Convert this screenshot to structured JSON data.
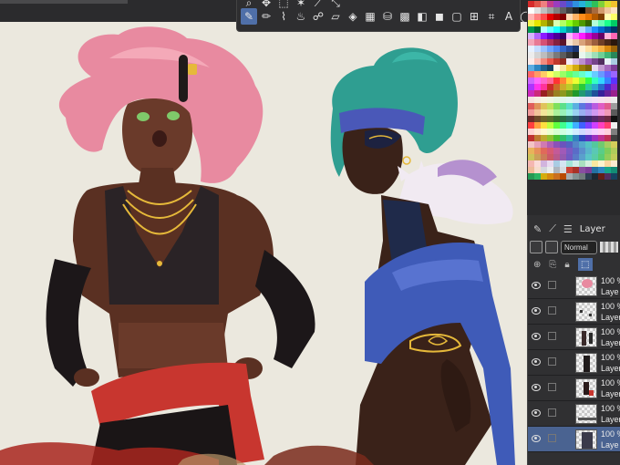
{
  "app": {
    "accent_color": "#4f6fa8",
    "panel_color": "#303032"
  },
  "toolbar": {
    "row1_tools": [
      {
        "name": "zoom-icon",
        "glyph": "⌕"
      },
      {
        "name": "move-icon",
        "glyph": "✥"
      },
      {
        "name": "selection-icon",
        "glyph": "⬚"
      },
      {
        "name": "magic-wand-icon",
        "glyph": "✶"
      },
      {
        "name": "eyedropper-icon",
        "glyph": "⟋"
      },
      {
        "name": "transform-icon",
        "glyph": "⤡"
      }
    ],
    "row2_tools": [
      {
        "name": "pen-icon",
        "glyph": "✎",
        "active": true
      },
      {
        "name": "pencil-icon",
        "glyph": "✏"
      },
      {
        "name": "brush-icon",
        "glyph": "⌇"
      },
      {
        "name": "airbrush-icon",
        "glyph": "♨"
      },
      {
        "name": "blend-icon",
        "glyph": "☍"
      },
      {
        "name": "eraser-icon",
        "glyph": "▱"
      },
      {
        "name": "fill-icon",
        "glyph": "◈"
      },
      {
        "name": "grid-icon",
        "glyph": "▦"
      },
      {
        "name": "bucket-icon",
        "glyph": "⛁"
      },
      {
        "name": "pattern-icon",
        "glyph": "▩"
      },
      {
        "name": "gradient-icon",
        "glyph": "◧"
      },
      {
        "name": "shape-icon",
        "glyph": "◼"
      },
      {
        "name": "rectangle-icon",
        "glyph": "▢"
      },
      {
        "name": "frame-icon",
        "glyph": "⊞"
      },
      {
        "name": "ruler-icon",
        "glyph": "⌗"
      },
      {
        "name": "text-icon",
        "glyph": "A"
      },
      {
        "name": "balloon-icon",
        "glyph": "◯"
      },
      {
        "name": "correction-icon",
        "glyph": "✐"
      }
    ]
  },
  "palette": {
    "colors": [
      "#d62b2b",
      "#e0554a",
      "#f08080",
      "#c43c8c",
      "#9b3dbf",
      "#6b49c9",
      "#3b5fd4",
      "#2f8fe0",
      "#26b1d8",
      "#21c2a0",
      "#2fbf5a",
      "#7fd13a",
      "#d7df30",
      "#f2c12e",
      "#ffffff",
      "#e0e0e0",
      "#c0c0c0",
      "#a0a0a0",
      "#808080",
      "#606060",
      "#404040",
      "#202020",
      "#000000",
      "#7a4b2a",
      "#a86a3d",
      "#d39b6c",
      "#f0c8a0",
      "#ffe1c4",
      "#ffb3b3",
      "#ff8080",
      "#ff4d4d",
      "#e60000",
      "#b30000",
      "#800000",
      "#ffd9b3",
      "#ffb366",
      "#ff8c1a",
      "#e67300",
      "#b35900",
      "#804000",
      "#ffffb3",
      "#ffff66",
      "#f5f54d",
      "#e6e600",
      "#b3b300",
      "#808000",
      "#d9ffb3",
      "#b3ff66",
      "#8cff1a",
      "#66cc00",
      "#4d9900",
      "#336600",
      "#b3ffd9",
      "#66ffb3",
      "#1aff8c",
      "#00cc66",
      "#009950",
      "#006633",
      "#b3ffff",
      "#66ffff",
      "#1affff",
      "#00cccc",
      "#009999",
      "#006666",
      "#b3d9ff",
      "#66b3ff",
      "#1a8cff",
      "#0066cc",
      "#004d99",
      "#003366",
      "#d9b3ff",
      "#b366ff",
      "#8c1aff",
      "#6600cc",
      "#4d0099",
      "#330066",
      "#ffb3ff",
      "#ff66ff",
      "#ff1aff",
      "#cc00cc",
      "#990099",
      "#660066",
      "#ffb3d9",
      "#ff66b3",
      "#f4a6b8",
      "#e87a95",
      "#d64f74",
      "#b03358",
      "#85213f",
      "#5c1529",
      "#f6e3d1",
      "#e9c6a6",
      "#d9a27b",
      "#c27f58",
      "#9c5e3d",
      "#6f3f27",
      "#4a2919",
      "#2b170d",
      "#e8f1ff",
      "#c6dcff",
      "#9cc1ff",
      "#6ea3ff",
      "#4f86f0",
      "#3566c9",
      "#264c9e",
      "#1a3572",
      "#fff1d6",
      "#ffe0a3",
      "#ffcc66",
      "#f5b041",
      "#d68910",
      "#9a6308",
      "#ededed",
      "#d4d4d4",
      "#bdbdbd",
      "#9e9e9e",
      "#7a7a7a",
      "#5c5c5c",
      "#3d3d3d",
      "#1f1f1f",
      "#e9f7ef",
      "#c8ecd6",
      "#9edfb9",
      "#6fcf97",
      "#40b676",
      "#27865a",
      "#fdecea",
      "#f9c0b8",
      "#f28c7f",
      "#e9584b",
      "#c0392b",
      "#922b21",
      "#f4ecf7",
      "#d7bde2",
      "#bb8fce",
      "#9b59b6",
      "#76448a",
      "#512e5f",
      "#eaf2f8",
      "#a9cce3",
      "#5dade2",
      "#2e86c1",
      "#1f618d",
      "#154360",
      "#fef9e7",
      "#f9e79f",
      "#f4d03f",
      "#d4ac0d",
      "#9a7d0a",
      "#7d6608",
      "#e8daef",
      "#c39bd3",
      "#a569bd",
      "#7d3c98",
      "#ff6666",
      "#ff9966",
      "#ffcc66",
      "#ffff66",
      "#ccff66",
      "#99ff66",
      "#66ff66",
      "#66ff99",
      "#66ffcc",
      "#66ffff",
      "#66ccff",
      "#6699ff",
      "#6666ff",
      "#9966ff",
      "#cc66ff",
      "#ff66ff",
      "#ff66cc",
      "#ff6699",
      "#ff3333",
      "#ff8533",
      "#ffd633",
      "#ebff33",
      "#99ff33",
      "#33ff47",
      "#33ffc2",
      "#33d6ff",
      "#3385ff",
      "#5c33ff",
      "#ad33ff",
      "#ff33eb",
      "#ff3399",
      "#cc2929",
      "#cc6b29",
      "#ccab29",
      "#bccc29",
      "#7acc29",
      "#29cc39",
      "#29cc9b",
      "#29abcc",
      "#296bcc",
      "#4a29cc",
      "#8a29cc",
      "#cc29bc",
      "#cc297a",
      "#992020",
      "#995020",
      "#998020",
      "#8d9920",
      "#5c9920",
      "#20992b",
      "#209974",
      "#208099",
      "#205099",
      "#372099",
      "#672099",
      "#99208d",
      "#f7e0e0",
      "#f7ece0",
      "#f7f4e0",
      "#f0f7e0",
      "#e4f7e0",
      "#e0f7ea",
      "#e0f7f5",
      "#e0eff7",
      "#e0e5f7",
      "#e8e0f7",
      "#f2e0f7",
      "#f7e0f0",
      "#f7e0e6",
      "#ebebeb",
      "#e05c5c",
      "#e0935c",
      "#e0c45c",
      "#c4e05c",
      "#7ee05c",
      "#5ce08a",
      "#5ce0c9",
      "#5cb0e0",
      "#5c76e0",
      "#7e5ce0",
      "#b85ce0",
      "#e05cc4",
      "#e05c8e",
      "#9c9c9c",
      "#f19a9a",
      "#f1c29a",
      "#f1e59a",
      "#dcf19a",
      "#abf19a",
      "#9af1b9",
      "#9af1e3",
      "#9ad2f1",
      "#9aaef1",
      "#ab9af1",
      "#d09af1",
      "#f19adf",
      "#f19ab6",
      "#5b5b5b",
      "#6d2a2a",
      "#6d4a2a",
      "#6d632a",
      "#5a6d2a",
      "#376d2a",
      "#2a6d41",
      "#2a6d62",
      "#2a536d",
      "#2a366d",
      "#3a2a6d",
      "#552a6d",
      "#6d2a5f",
      "#6d2a41",
      "#111111",
      "#ff4040",
      "#ffa040",
      "#ffe040",
      "#c0ff40",
      "#60ff40",
      "#40ff90",
      "#40ffe0",
      "#40b0ff",
      "#4060ff",
      "#8040ff",
      "#d040ff",
      "#ff40c0",
      "#ff4070",
      "#f0f0f0",
      "#ffd0d0",
      "#ffe6d0",
      "#fff8d0",
      "#ecffd0",
      "#d6ffd0",
      "#d0ffe2",
      "#d0fff7",
      "#d0ecff",
      "#d0d9ff",
      "#e2d0ff",
      "#f4d0ff",
      "#ffd0f2",
      "#ffd0dc",
      "#7f7f7f",
      "#bf3030",
      "#bf7830",
      "#bfa830",
      "#90bf30",
      "#48bf30",
      "#30bf6c",
      "#30bfa8",
      "#3084bf",
      "#3048bf",
      "#6030bf",
      "#9c30bf",
      "#bf3090",
      "#bf3054",
      "#3f3f3f",
      "#f3c5c5",
      "#e6a0b8",
      "#d07ab2",
      "#b05fb5",
      "#8a52b8",
      "#6b54bd",
      "#5463c2",
      "#5486c8",
      "#54a8cc",
      "#54c2c4",
      "#54c79e",
      "#70c970",
      "#a6cc60",
      "#d4ce5a",
      "#e8b35a",
      "#e6905a",
      "#e06a5a",
      "#d65a74",
      "#c45a98",
      "#a05ab8",
      "#7a5ac2",
      "#5a6cc8",
      "#5a90cc",
      "#5ab4cc",
      "#5ac8b4",
      "#5acc88",
      "#7ecc5a",
      "#b0cc5a",
      "#ccc45a",
      "#cca05a",
      "#cc7c5a",
      "#cc5a66",
      "#b85a8c",
      "#945ab0",
      "#705ac2",
      "#5a7ac8",
      "#5aa0cc",
      "#5ac4c8",
      "#5acca6",
      "#5acc74",
      "#92cc5a",
      "#c2cc5a",
      "#f5b7b1",
      "#fadbd8",
      "#d2b4de",
      "#e8daef",
      "#a9cce3",
      "#d4e6f1",
      "#a3e4d7",
      "#d0ece7",
      "#a9dfbf",
      "#d4efdf",
      "#f9e79f",
      "#fcf3cf",
      "#fad7a0",
      "#fdebd0",
      "#edbb99",
      "#f6ddcc",
      "#d5d8dc",
      "#eaeded",
      "#aeb6bf",
      "#d6dbdf",
      "#cb4335",
      "#a93226",
      "#884ea0",
      "#7d3c98",
      "#2471a3",
      "#2e86c1",
      "#17a589",
      "#138d75",
      "#229954",
      "#28b463",
      "#d4ac0d",
      "#d68910",
      "#ca6f1e",
      "#ba4a00",
      "#a6acaf",
      "#839192",
      "#707b7c",
      "#2e4053",
      "#1c2833",
      "#641e16",
      "#512e5f",
      "#154360"
    ]
  },
  "layers_panel": {
    "tab_label": "Layer",
    "blend_mode": "Normal",
    "rows": [
      {
        "opacity": "100 %",
        "name": "Laye",
        "thumb": "pink",
        "selected": false
      },
      {
        "opacity": "100 %",
        "name": "Layer",
        "thumb": "dots",
        "selected": false
      },
      {
        "opacity": "100 %",
        "name": "Layer",
        "thumb": "figure",
        "selected": false
      },
      {
        "opacity": "100 %",
        "name": "Layer",
        "thumb": "dark",
        "selected": false
      },
      {
        "opacity": "100 %",
        "name": "Layer",
        "thumb": "red",
        "selected": false
      },
      {
        "opacity": "100 %",
        "name": "Layer",
        "thumb": "strip",
        "selected": false
      },
      {
        "opacity": "100 %",
        "name": "Laye",
        "thumb": "figure2",
        "selected": true
      }
    ]
  }
}
